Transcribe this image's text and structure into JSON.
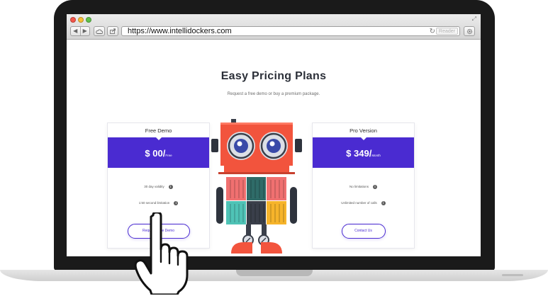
{
  "browser": {
    "url": "https://www.intellidockers.com",
    "reader_label": "Reader",
    "icons": {
      "back": "chevron-left-icon",
      "forward": "chevron-right-icon",
      "cloud": "cloud-icon",
      "share": "share-icon",
      "reload": "reload-icon",
      "settings": "gear-icon",
      "expand": "expand-icon"
    }
  },
  "page": {
    "title": "Easy Pricing Plans",
    "subtitle": "Request a free demo or buy a premium package.",
    "accent_color": "#4a2bd1",
    "plans": [
      {
        "name": "Free Demo",
        "price": "$ 00/",
        "period": "Free",
        "features": [
          "30 day validity",
          "1:50 second limitation"
        ],
        "cta": "Request Free Demo"
      },
      {
        "name": "Pro Version",
        "price": "$ 349/",
        "period": "Month",
        "features": [
          "No limitations",
          "Unlimited number of calls"
        ],
        "cta": "Contact Us"
      }
    ]
  },
  "illustrations": {
    "robot": "robot-mascot-illustration",
    "cursor": "pointing-hand-cursor"
  }
}
